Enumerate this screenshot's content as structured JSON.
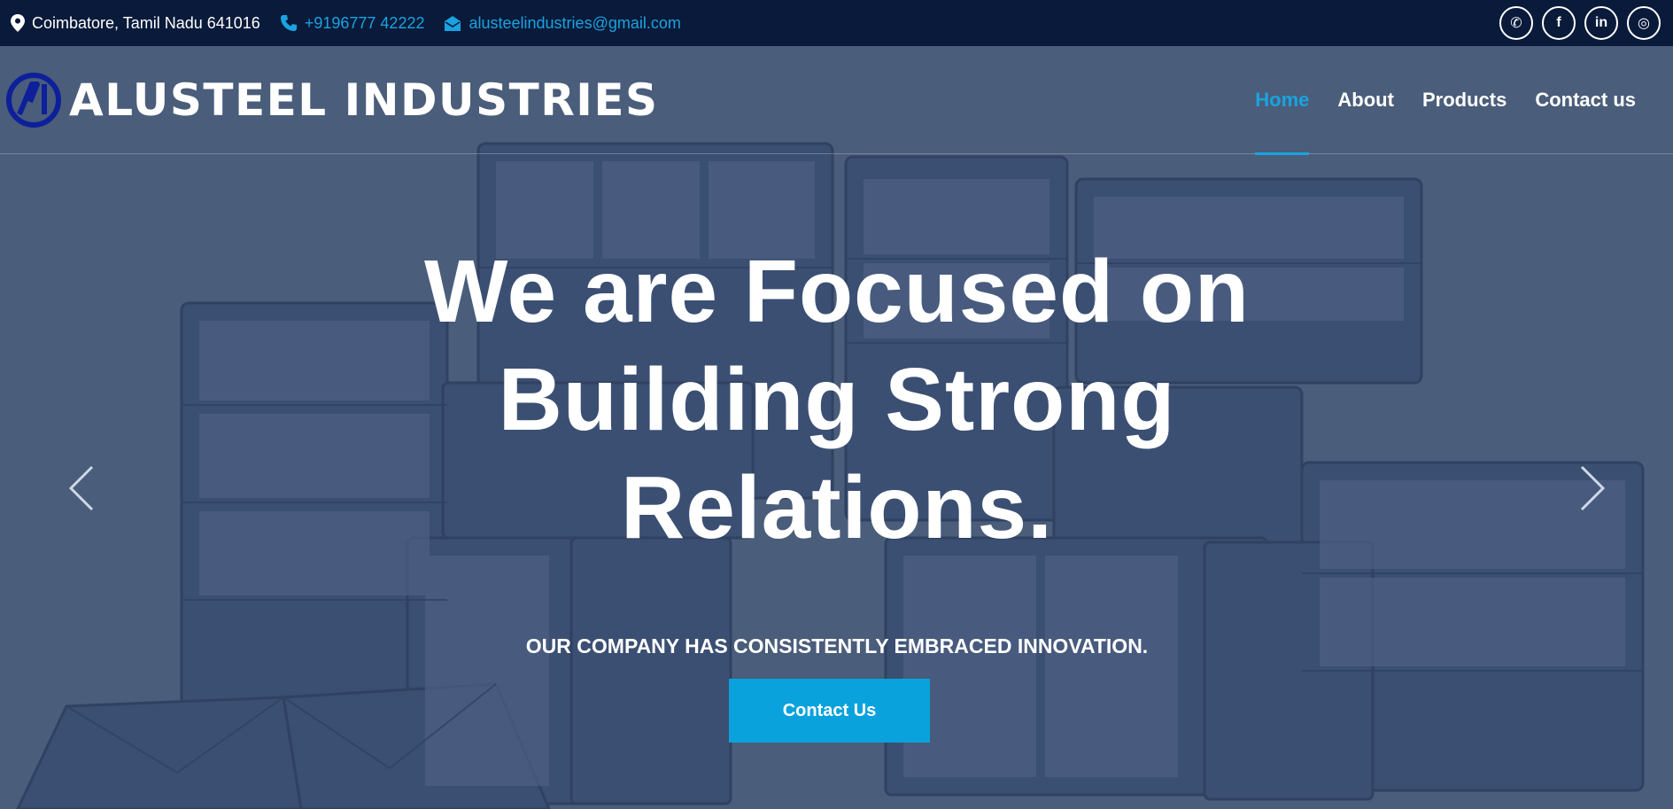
{
  "topbar": {
    "location": "Coimbatore, Tamil Nadu 641016",
    "phone": "+9196777 42222",
    "email": "alusteelindustries@gmail.com",
    "social": [
      {
        "icon": "whatsapp-icon",
        "glyph": "✆"
      },
      {
        "icon": "facebook-icon",
        "glyph": "f"
      },
      {
        "icon": "linkedin-icon",
        "glyph": "in"
      },
      {
        "icon": "instagram-icon",
        "glyph": "◎"
      }
    ]
  },
  "brand": {
    "name": "ALUSTEEL INDUSTRIES",
    "logo_color": "#0e1f9a"
  },
  "nav": {
    "items": [
      {
        "label": "Home",
        "active": true
      },
      {
        "label": "About",
        "active": false
      },
      {
        "label": "Products",
        "active": false
      },
      {
        "label": "Contact us",
        "active": false
      }
    ]
  },
  "hero": {
    "title_line1": "We are Focused on",
    "title_line2": "Building Strong",
    "title_line3": "Relations.",
    "subtitle": "OUR COMPANY HAS CONSISTENTLY EMBRACED INNOVATION.",
    "cta_label": "Contact Us"
  },
  "colors": {
    "topbar_bg": "#0a1a3a",
    "accent": "#1aa3e0",
    "cta": "#0aa2dc",
    "hero_tint": "#4a5d7b"
  }
}
